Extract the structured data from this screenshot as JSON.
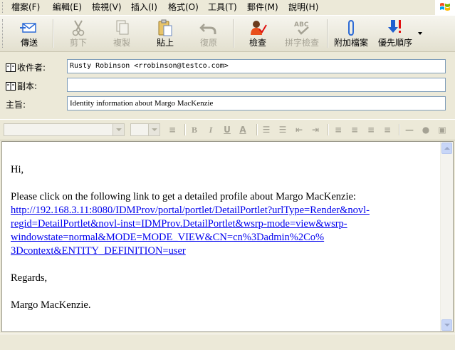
{
  "menu": {
    "items": [
      "檔案(F)",
      "編輯(E)",
      "檢視(V)",
      "插入(I)",
      "格式(O)",
      "工具(T)",
      "郵件(M)",
      "說明(H)"
    ]
  },
  "toolbar": {
    "send": "傳送",
    "cut": "剪下",
    "copy": "複製",
    "paste": "貼上",
    "undo": "復原",
    "check": "檢查",
    "spelling": "拼字檢查",
    "attach": "附加檔案",
    "priority": "優先順序",
    "spelling_icon_text": "ABC"
  },
  "header": {
    "to_label": "收件者:",
    "to_value": "Rusty Robinson <rrobinson@testco.com>",
    "cc_label": "副本:",
    "cc_value": "",
    "subject_label": "主旨:",
    "subject_value": "Identity information about Margo MacKenzie"
  },
  "format": {
    "bold": "B",
    "italic": "I",
    "underline": "U",
    "font_color": "A"
  },
  "message": {
    "greeting": "Hi,",
    "intro": "Please click on the following link to get a detailed profile about Margo MacKenzie:",
    "link_lines": [
      "http://192.168.3.11:8080/IDMProv/portal/portlet/DetailPortlet?urlType=Render&novl-",
      "regid=DetailPortlet&novl-inst=IDMProv.DetailPortlet&wsrp-mode=view&wsrp-",
      "windowstate=normal&MODE=MODE_VIEW&CN=cn%3Dadmin%2Co%",
      "3Dcontext&ENTITY_DEFINITION=user"
    ],
    "closing": "Regards,",
    "signature": "Margo MacKenzie."
  },
  "colors": {
    "link": "#0000ee",
    "send_icon": "#2d6bd6",
    "attach_icon": "#2d6bd6",
    "priority_arrow": "#1f5fd0",
    "priority_bang": "#e01010"
  }
}
